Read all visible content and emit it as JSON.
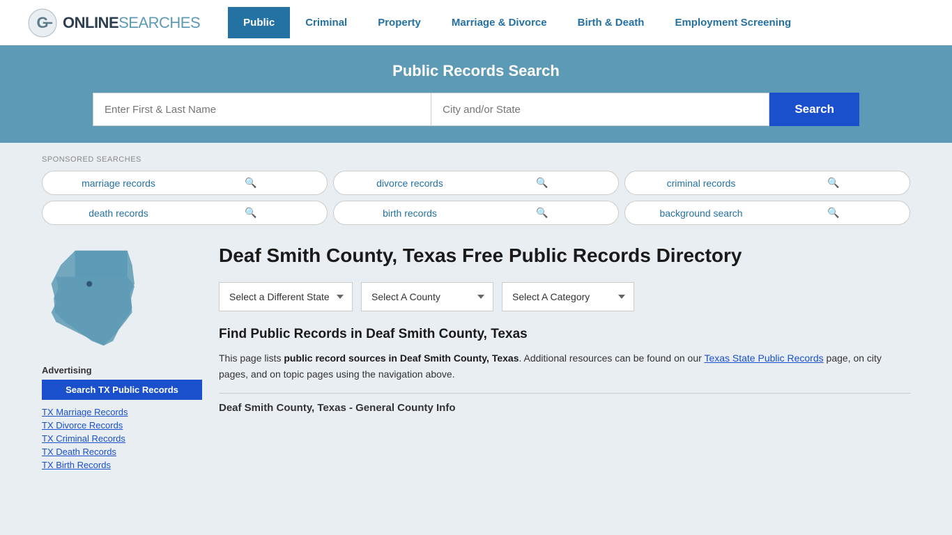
{
  "logo": {
    "icon_text": "G",
    "brand_text": "ONLINE",
    "brand_text2": "SEARCHES"
  },
  "nav": {
    "items": [
      {
        "label": "Public",
        "active": true
      },
      {
        "label": "Criminal",
        "active": false
      },
      {
        "label": "Property",
        "active": false
      },
      {
        "label": "Marriage & Divorce",
        "active": false
      },
      {
        "label": "Birth & Death",
        "active": false
      },
      {
        "label": "Employment Screening",
        "active": false
      }
    ]
  },
  "search_banner": {
    "title": "Public Records Search",
    "name_placeholder": "Enter First & Last Name",
    "location_placeholder": "City and/or State",
    "search_button": "Search"
  },
  "sponsored": {
    "label": "SPONSORED SEARCHES",
    "pills": [
      {
        "text": "marriage records"
      },
      {
        "text": "divorce records"
      },
      {
        "text": "criminal records"
      },
      {
        "text": "death records"
      },
      {
        "text": "birth records"
      },
      {
        "text": "background search"
      }
    ]
  },
  "sidebar": {
    "advertising_label": "Advertising",
    "ad_button": "Search TX Public Records",
    "links": [
      "TX Marriage Records",
      "TX Divorce Records",
      "TX Criminal Records",
      "TX Death Records",
      "TX Birth Records"
    ]
  },
  "main_content": {
    "page_title": "Deaf Smith County, Texas Free Public Records Directory",
    "dropdowns": {
      "state": "Select a Different State",
      "county": "Select A County",
      "category": "Select A Category"
    },
    "find_title": "Find Public Records in Deaf Smith County, Texas",
    "description_part1": "This page lists ",
    "description_bold": "public record sources in Deaf Smith County, Texas",
    "description_part2": ". Additional resources can be found on our ",
    "description_link": "Texas State Public Records",
    "description_part3": " page, on city pages, and on topic pages using the navigation above.",
    "county_info_title": "Deaf Smith County, Texas - General County Info"
  }
}
